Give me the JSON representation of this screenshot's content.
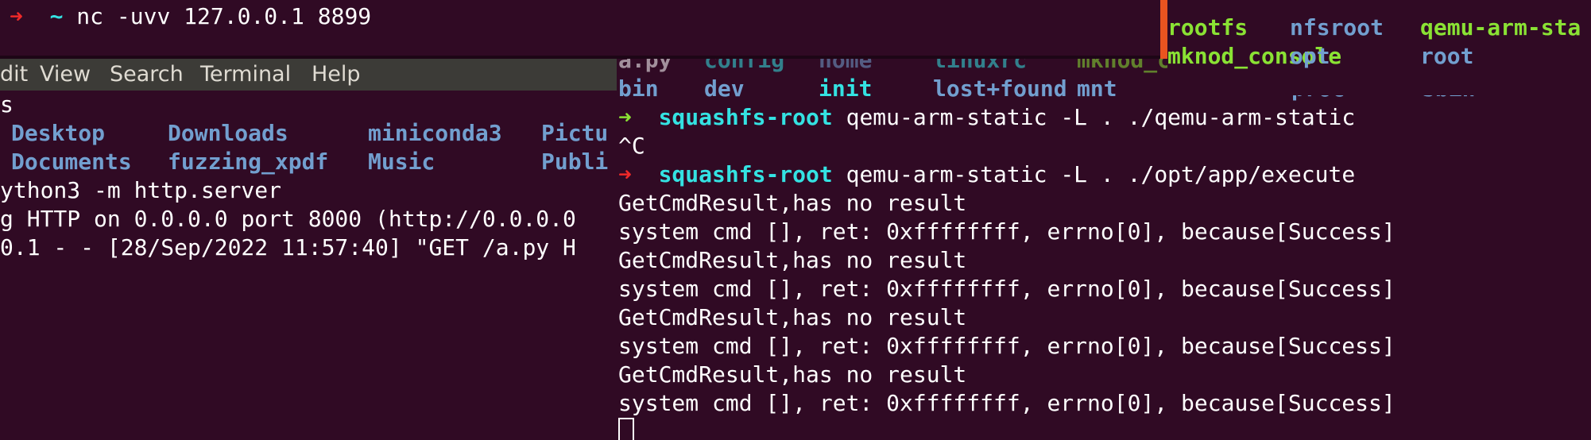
{
  "top_terminal": {
    "arrow": "➜",
    "cwd": "~",
    "command": "nc -uvv 127.0.0.1 8899"
  },
  "left_terminal": {
    "menu": [
      "dit",
      "View",
      "Search",
      "Terminal",
      "Help"
    ],
    "first_line": "s",
    "ls_rows": [
      [
        "Desktop",
        "Downloads",
        "miniconda3",
        "Pictu"
      ],
      [
        "Documents",
        "fuzzing_xpdf",
        "Music",
        "Publi"
      ]
    ],
    "lines": [
      "ython3 -m http.server",
      "g HTTP on 0.0.0.0 port 8000 (http://0.0.0.0",
      "0.1 - - [28/Sep/2022 11:57:40] \"GET /a.py H"
    ]
  },
  "right_terminal": {
    "partial_row": [
      "a.py",
      "config",
      "home",
      "linuxrc",
      "mknod_console",
      "opt",
      "root"
    ],
    "ls_top": [
      "rootfs",
      "nfsroot",
      "qemu-arm-sta"
    ],
    "ls_row": [
      "bin",
      "dev",
      "init",
      "lost+found",
      "mnt",
      "proc",
      "sbin"
    ],
    "prompt_arrow": "➜",
    "prompt_dir": "squashfs-root",
    "cmd1": "qemu-arm-static -L . ./qemu-arm-static",
    "ctrl_c": "^C",
    "cmd2": "qemu-arm-static -L . ./opt/app/execute",
    "output": [
      "GetCmdResult,has no result",
      "system cmd [], ret: 0xffffffff, errno[0], because[Success]",
      "GetCmdResult,has no result",
      "system cmd [], ret: 0xffffffff, errno[0], because[Success]",
      "GetCmdResult,has no result",
      "system cmd [], ret: 0xffffffff, errno[0], because[Success]",
      "GetCmdResult,has no result",
      "system cmd [], ret: 0xffffffff, errno[0], because[Success]"
    ]
  },
  "colors": {
    "background": "#300a24",
    "prompt_green": "#8ae234",
    "prompt_red": "#ef2929",
    "directory_cyan": "#34e2e2",
    "directory_blue": "#729fcf",
    "scrollbar_orange": "#e95420",
    "menubar": "#3c3b37"
  }
}
